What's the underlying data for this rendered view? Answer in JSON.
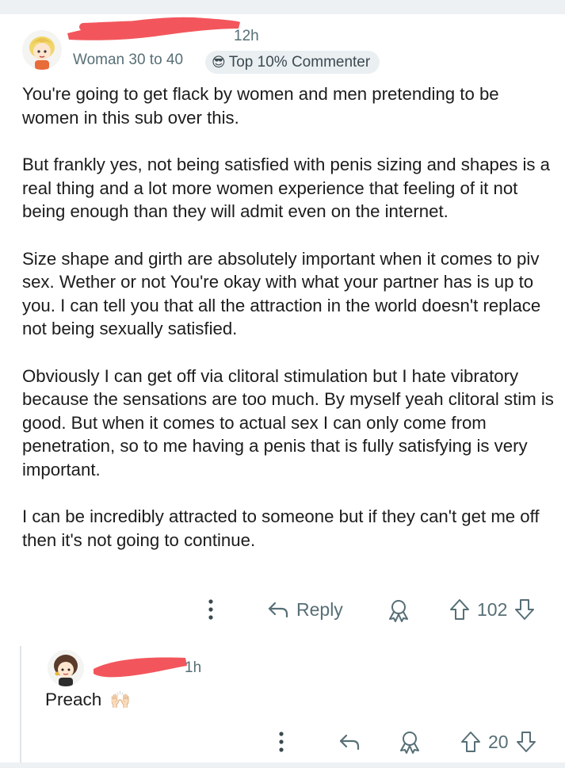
{
  "comment": {
    "timestamp": "12h",
    "user_flair": "Woman 30 to 40",
    "badge": {
      "icon": "sunglasses-emoji-icon",
      "label": "Top 10% Commenter"
    },
    "paragraphs": [
      "You're going to get flack by women and men pretending to be women in this sub over this.",
      "But frankly yes, not being satisfied with penis sizing and shapes is a real thing and a lot more women experience that feeling of it not being enough than they will admit even on the internet.",
      "Size shape and girth are absolutely important when it comes to piv sex. Wether or not You're okay with what your partner has is up to you. I can tell you that all the attraction in the world doesn't replace not being sexually satisfied.",
      "Obviously I can get off via clitoral stimulation but I hate vibratory because the sensations are too much. By myself yeah clitoral stim is good. But when it comes to actual sex I can only come from penetration, so to me having a penis that is fully satisfying is very important.",
      "I can be incredibly attracted to someone but if they can't get me off then it's not going to continue."
    ],
    "actions": {
      "reply_label": "Reply",
      "vote_count": "102"
    }
  },
  "reply": {
    "timestamp": "1h",
    "text": "Preach",
    "emoji": "🙌🏻",
    "actions": {
      "vote_count": "20"
    }
  },
  "colors": {
    "redaction": "#f2565c",
    "meta_text": "#576f76",
    "badge_bg": "#eaeff2"
  }
}
